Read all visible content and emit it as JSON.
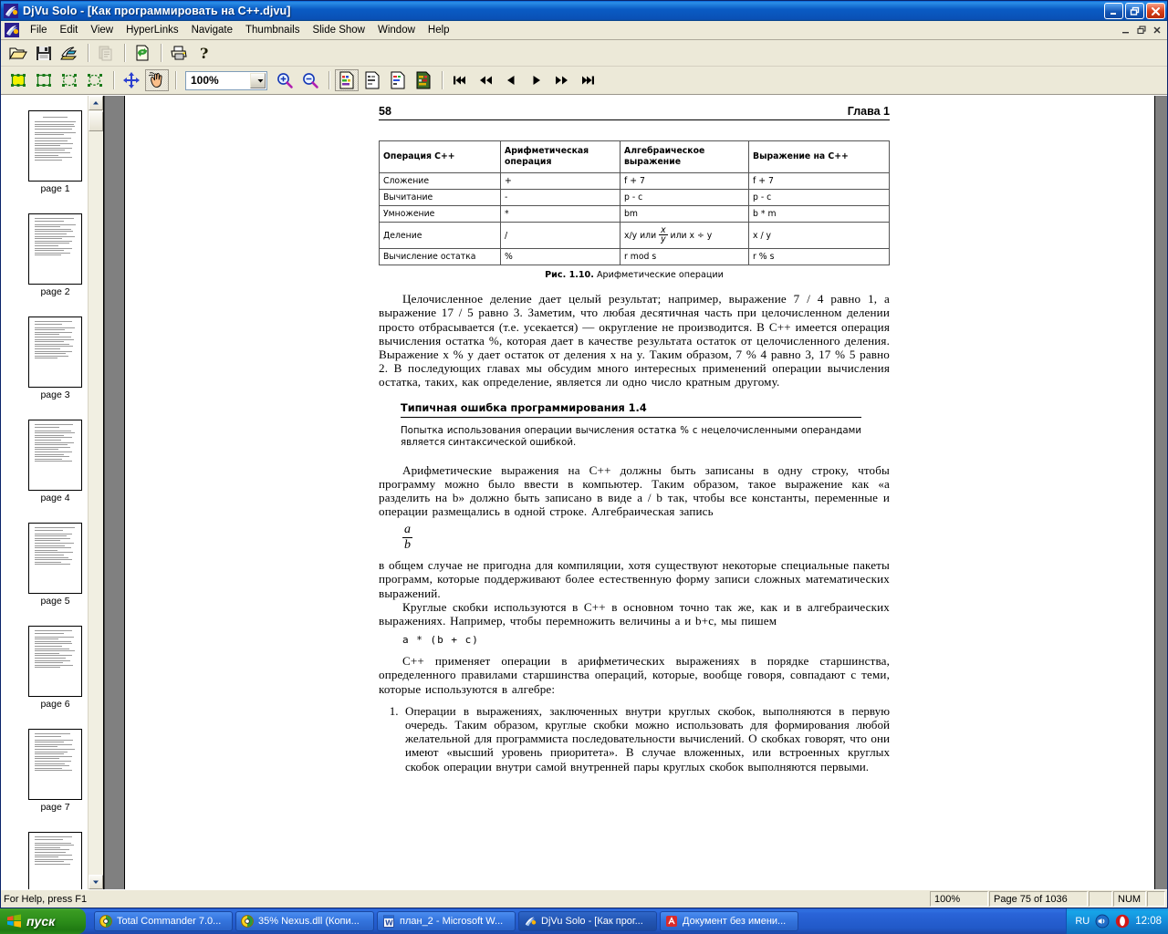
{
  "window": {
    "title": "DjVu Solo - [Как программировать на C++.djvu]",
    "app_icon": "djvu-icon",
    "buttons": {
      "minimize": "–",
      "restore": "❐",
      "close": "✕"
    },
    "mdi_buttons": {
      "minimize": "_",
      "restore": "❐",
      "close": "✕"
    }
  },
  "menubar": {
    "items": [
      {
        "label": "File"
      },
      {
        "label": "Edit"
      },
      {
        "label": "View"
      },
      {
        "label": "HyperLinks"
      },
      {
        "label": "Navigate"
      },
      {
        "label": "Thumbnails"
      },
      {
        "label": "Slide Show"
      },
      {
        "label": "Window"
      },
      {
        "label": "Help"
      }
    ]
  },
  "toolbar_main": {
    "buttons": [
      {
        "name": "open-icon",
        "tooltip": "Open"
      },
      {
        "name": "save-icon",
        "tooltip": "Save"
      },
      {
        "name": "export-icon",
        "tooltip": "Export"
      },
      {
        "name": "copy-icon",
        "tooltip": "Copy",
        "disabled": true
      },
      {
        "name": "refresh-page-icon",
        "tooltip": "Refresh"
      },
      {
        "name": "print-icon",
        "tooltip": "Print"
      },
      {
        "name": "help-icon",
        "tooltip": "About"
      }
    ]
  },
  "toolbar_view": {
    "select_tools": [
      {
        "name": "select-rect-filled-icon"
      },
      {
        "name": "select-rect-icon"
      },
      {
        "name": "select-oval-icon"
      },
      {
        "name": "select-lasso-icon"
      }
    ],
    "pan_tool": {
      "name": "pan-icon"
    },
    "hand_tool": {
      "name": "hand-icon",
      "active": true
    },
    "zoom": {
      "value": "100%",
      "dropdown_icon": "chevron-down-icon"
    },
    "zoom_in": {
      "name": "zoom-in-icon"
    },
    "zoom_out": {
      "name": "zoom-out-icon"
    },
    "display_modes": [
      {
        "name": "display-color-icon",
        "active": true
      },
      {
        "name": "display-bw-icon"
      },
      {
        "name": "display-foreground-icon"
      },
      {
        "name": "display-background-icon"
      }
    ],
    "navigation": [
      {
        "name": "first-page-icon"
      },
      {
        "name": "prev-page-fast-icon"
      },
      {
        "name": "prev-page-icon"
      },
      {
        "name": "next-page-icon"
      },
      {
        "name": "next-page-fast-icon"
      },
      {
        "name": "last-page-icon"
      }
    ]
  },
  "thumbnails": {
    "items": [
      {
        "label": "page 1"
      },
      {
        "label": "page 2"
      },
      {
        "label": "page 3"
      },
      {
        "label": "page 4"
      },
      {
        "label": "page 5"
      },
      {
        "label": "page 6"
      },
      {
        "label": "page 7"
      }
    ]
  },
  "document": {
    "header": {
      "page_number": "58",
      "chapter": "Глава 1"
    },
    "table": {
      "columns": [
        "Операция C++",
        "Арифметическая операция",
        "Алгебраическое выражение",
        "Выражение на C++"
      ],
      "rows": [
        {
          "op": "Сложение",
          "arith": "+",
          "algebraic": "f + 7",
          "cpp": "f + 7"
        },
        {
          "op": "Вычитание",
          "arith": "-",
          "algebraic": "p - c",
          "cpp": "p - c"
        },
        {
          "op": "Умножение",
          "arith": "*",
          "algebraic": "bm",
          "cpp": "b * m"
        },
        {
          "op": "Деление",
          "arith": "/",
          "algebraic": "x/y или x/y или x ÷ y",
          "algebraic_parts": {
            "pre": "x/y или ",
            "frac_num": "x",
            "frac_den": "y",
            "post": " или x ÷ y"
          },
          "cpp": "x / y"
        },
        {
          "op": "Вычисление остатка",
          "arith": "%",
          "algebraic": "r mod s",
          "cpp": "r % s"
        }
      ],
      "caption_label": "Рис. 1.10.",
      "caption_text": " Арифметические операции"
    },
    "paragraphs": {
      "p1": "Целочисленное деление дает целый результат; например, выражение 7 / 4 равно 1, а выражение 17 / 5 равно 3. Заметим, что любая десятичная часть при целочисленном делении просто отбрасывается (т.е. усекается) — округление не производится. В С++ имеется операция вычисления остатка %, которая дает в качестве результата остаток от целочисленного деления. Выражение x % y дает остаток от деления x на y. Таким образом, 7 % 4 равно 3, 17 % 5 равно 2. В последующих главах мы обсудим много интересных применений операции вычисления остатка, таких, как определение, является ли одно число кратным другому.",
      "error_title": "Типичная ошибка программирования 1.4",
      "error_text": "Попытка использования операции вычисления остатка % с нецелочисленными операндами является синтаксической ошибкой.",
      "p2": "Арифметические выражения на C++ должны быть записаны в одну строку, чтобы программу можно было ввести в компьютер. Таким образом, такое выражение как «a разделить на b» должно быть записано в виде a / b так, чтобы все константы, переменные и операции размещались в одной строке. Алгебраическая запись",
      "frac_num": "a",
      "frac_den": "b",
      "p3": "в общем случае не пригодна для компиляции, хотя существуют некоторые специальные пакеты программ, которые поддерживают более естественную форму записи сложных математических выражений.",
      "p4": "Круглые скобки используются в C++ в основном точно так же, как и в алгебраических выражениях. Например, чтобы перемножить величины a и b+c, мы пишем",
      "code1": "a * (b + c)",
      "p5": "C++ применяет операции в арифметических выражениях в порядке старшинства, определенного правилами старшинства операций, которые, вообще говоря, совпадают с теми, которые используются в алгебре:",
      "rule1": "Операции в выражениях, заключенных внутри круглых скобок, выполняются в первую очередь. Таким образом, круглые скобки можно использовать для формирования любой желательной для программиста последовательности вычислений. О скобках говорят, что они имеют «высший уровень приоритета». В случае вложенных, или встроенных круглых скобок операции внутри самой внутренней пары круглых скобок выполняются первыми."
    }
  },
  "statusbar": {
    "help_text": "For Help, press F1",
    "zoom": "100%",
    "page": "Page 75 of 1036",
    "spare": "",
    "num_lock": "NUM",
    "trailing": ""
  },
  "taskbar": {
    "start_label": "пуск",
    "tasks": [
      {
        "label": "Total Commander 7.0...",
        "icon": "total-commander-icon",
        "active": false
      },
      {
        "label": "35% Nexus.dll (Копи...",
        "icon": "total-commander-icon",
        "active": false
      },
      {
        "label": "план_2 - Microsoft W...",
        "icon": "word-icon",
        "active": false
      },
      {
        "label": "DjVu Solo - [Как прог...",
        "icon": "djvu-icon",
        "active": true
      },
      {
        "label": "Документ без имени...",
        "icon": "generic-app-icon",
        "active": false
      }
    ],
    "tray": {
      "language": "RU",
      "icons": [
        "volume-icon",
        "opera-icon"
      ],
      "clock": "12:08"
    }
  },
  "colors": {
    "titlebar_blue": "#0a5bc4",
    "taskbar_blue": "#2159c8",
    "start_green": "#2e8f1b",
    "face": "#ece9d8",
    "doc_gray": "#808080"
  }
}
